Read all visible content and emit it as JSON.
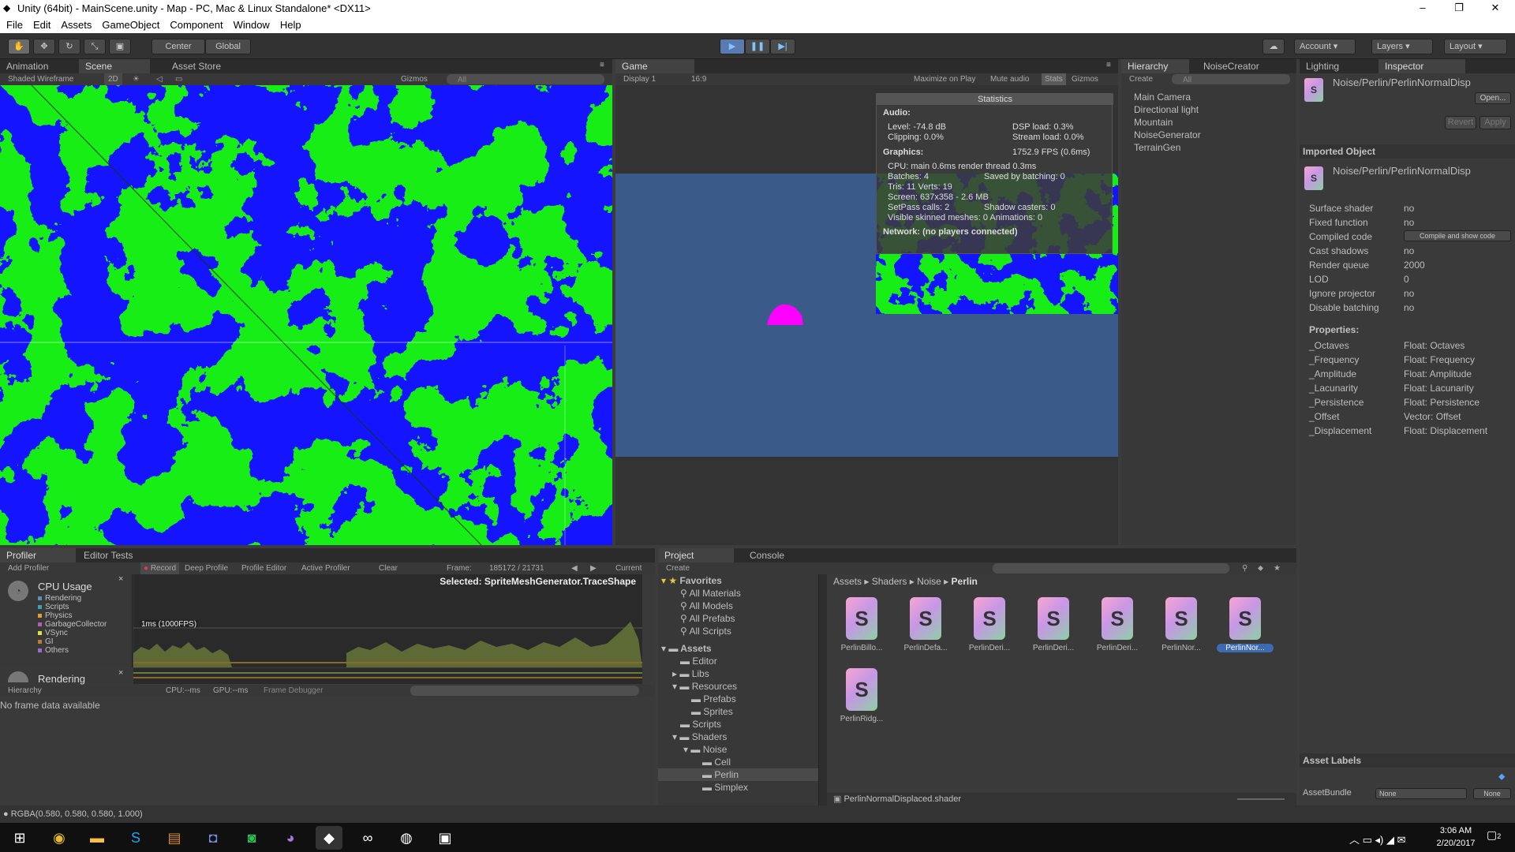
{
  "window": {
    "title": "Unity (64bit) - MainScene.unity - Map - PC, Mac & Linux Standalone* <DX11>",
    "minimize": "–",
    "maximize": "❐",
    "close": "✕"
  },
  "menu": [
    "File",
    "Edit",
    "Assets",
    "GameObject",
    "Component",
    "Window",
    "Help"
  ],
  "toolbar": {
    "pivot": "Center",
    "space": "Global",
    "account": "Account",
    "layers": "Layers",
    "layout": "Layout",
    "play_icon": "play-icon",
    "pause_icon": "pause-icon",
    "step_icon": "step-icon"
  },
  "scene_panel": {
    "tabs": [
      "Animation",
      "Scene",
      "Asset Store"
    ],
    "shading": "Shaded Wireframe",
    "mode2d": "2D",
    "gizmos": "Gizmos",
    "search_placeholder": "All"
  },
  "game_panel": {
    "tab": "Game",
    "display": "Display 1",
    "aspect": "16:9",
    "maximize": "Maximize on Play",
    "mute": "Mute audio",
    "stats": "Stats",
    "gizmos": "Gizmos",
    "statistics": {
      "title": "Statistics",
      "audio_label": "Audio:",
      "level": "Level: -74.8 dB",
      "clipping": "Clipping: 0.0%",
      "dsp": "DSP load: 0.3%",
      "stream": "Stream load: 0.0%",
      "graphics_label": "Graphics:",
      "fps": "1752.9 FPS (0.6ms)",
      "cpu": "CPU: main 0.6ms  render thread 0.3ms",
      "batches": "Batches: 4",
      "saved": "Saved by batching: 0",
      "tris": "Tris: 11   Verts: 19",
      "screen": "Screen: 637x358 - 2.6 MB",
      "setpass": "SetPass calls: 2",
      "shadow": "Shadow casters: 0",
      "skinned": "Visible skinned meshes: 0  Animations: 0",
      "network": "Network: (no players connected)"
    }
  },
  "hierarchy": {
    "tabs": [
      "Hierarchy",
      "NoiseCreator"
    ],
    "create": "Create",
    "search_placeholder": "All",
    "items": [
      "Main Camera",
      "Directional light",
      "Mountain",
      "NoiseGenerator",
      "TerrainGen"
    ]
  },
  "inspector": {
    "tabs": [
      "Lighting",
      "Inspector"
    ],
    "shader_name": "Noise/Perlin/PerlinNormalDisp",
    "open": "Open...",
    "revert": "Revert",
    "apply": "Apply",
    "imported_header": "Imported Object",
    "imported_name": "Noise/Perlin/PerlinNormalDisp",
    "rows": [
      {
        "k": "Surface shader",
        "v": "no"
      },
      {
        "k": "Fixed function",
        "v": "no"
      },
      {
        "k": "Compiled code",
        "v": "Compile and show code"
      },
      {
        "k": "Cast shadows",
        "v": "no"
      },
      {
        "k": "Render queue",
        "v": "2000"
      },
      {
        "k": "LOD",
        "v": "0"
      },
      {
        "k": "Ignore projector",
        "v": "no"
      },
      {
        "k": "Disable batching",
        "v": "no"
      }
    ],
    "properties_label": "Properties:",
    "properties": [
      {
        "k": "_Octaves",
        "v": "Float: Octaves"
      },
      {
        "k": "_Frequency",
        "v": "Float: Frequency"
      },
      {
        "k": "_Amplitude",
        "v": "Float: Amplitude"
      },
      {
        "k": "_Lacunarity",
        "v": "Float: Lacunarity"
      },
      {
        "k": "_Persistence",
        "v": "Float: Persistence"
      },
      {
        "k": "_Offset",
        "v": "Vector: Offset"
      },
      {
        "k": "_Displacement",
        "v": "Float: Displacement"
      }
    ],
    "asset_labels": "Asset Labels",
    "assetbundle_label": "AssetBundle",
    "assetbundle_value": "None",
    "assetbundle_variant": "None"
  },
  "profiler": {
    "tabs": [
      "Profiler",
      "Editor Tests"
    ],
    "add": "Add Profiler",
    "record": "Record",
    "deep": "Deep Profile",
    "editor": "Profile Editor",
    "active": "Active Profiler",
    "clear": "Clear",
    "frame_label": "Frame:",
    "frame_value": "185172 / 21731",
    "current": "Current",
    "cpu_title": "CPU Usage",
    "legend": [
      "Rendering",
      "Scripts",
      "Physics",
      "GarbageCollector",
      "VSync",
      "GI",
      "Others"
    ],
    "legend_colors": [
      "#5a8cc8",
      "#3ba3a3",
      "#e0a030",
      "#b65ab6",
      "#e0e040",
      "#bf7a38",
      "#9a6ad0"
    ],
    "selected": "Selected: SpriteMeshGenerator.TraceShape",
    "ms_label": "1ms (1000FPS)",
    "rendering_title": "Rendering",
    "hierarchy_dd": "Hierarchy",
    "cpu_ms": "CPU:--ms",
    "gpu_ms": "GPU:--ms",
    "frame_debugger": "Frame Debugger",
    "no_data": "No frame data available"
  },
  "project": {
    "tabs": [
      "Project",
      "Console"
    ],
    "create": "Create",
    "favorites": "Favorites",
    "fav_items": [
      "All Materials",
      "All Models",
      "All Prefabs",
      "All Scripts"
    ],
    "assets_root": "Assets",
    "tree": [
      {
        "name": "Editor",
        "depth": 1
      },
      {
        "name": "Libs",
        "depth": 1
      },
      {
        "name": "Resources",
        "depth": 1
      },
      {
        "name": "Prefabs",
        "depth": 2
      },
      {
        "name": "Sprites",
        "depth": 2
      },
      {
        "name": "Scripts",
        "depth": 1
      },
      {
        "name": "Shaders",
        "depth": 1
      },
      {
        "name": "Noise",
        "depth": 2
      },
      {
        "name": "Cell",
        "depth": 3
      },
      {
        "name": "Perlin",
        "depth": 3
      },
      {
        "name": "Simplex",
        "depth": 3
      }
    ],
    "breadcrumb": [
      "Assets",
      "Shaders",
      "Noise",
      "Perlin"
    ],
    "files": [
      "PerlinBillo...",
      "PerlinDefa...",
      "PerlinDeri...",
      "PerlinDeri...",
      "PerlinDeri...",
      "PerlinNor...",
      "PerlinNor...",
      "PerlinRidg..."
    ],
    "selected_file": "PerlinNormalDisplaced.shader"
  },
  "statusbar": {
    "text": "RGBA(0.580, 0.580, 0.580, 1.000)"
  },
  "taskbar": {
    "time": "3:06 AM",
    "date": "2/20/2017",
    "notif": "2"
  },
  "colors": {
    "noise_green": "#14ee14",
    "noise_blue": "#1414ff",
    "game_bg": "#3a5a8a",
    "magenta": "#ff00ff",
    "selection": "#3d6bb3"
  }
}
